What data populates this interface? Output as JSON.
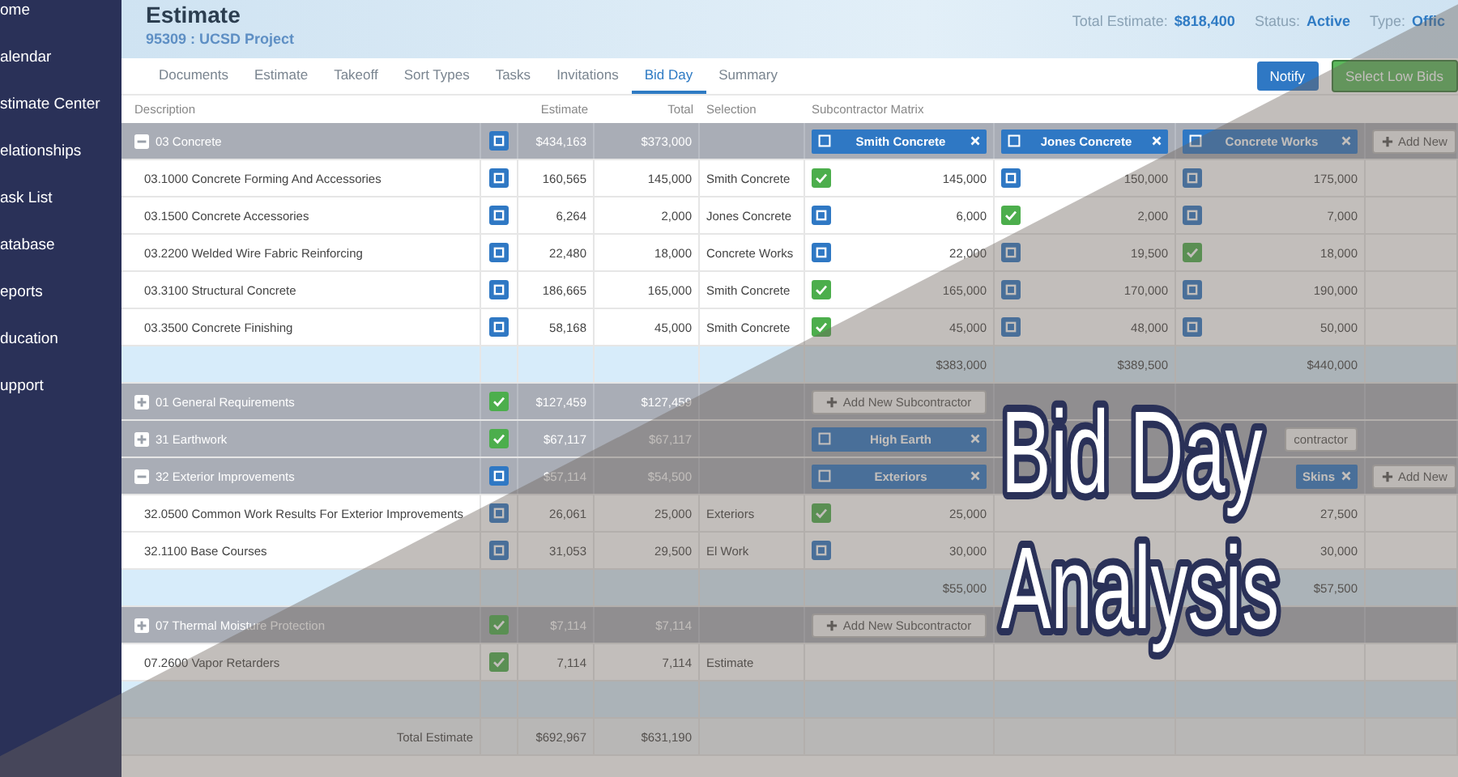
{
  "sidebar": {
    "items": [
      "ome",
      "alendar",
      "stimate Center",
      "elationships",
      "ask List",
      "atabase",
      "eports",
      "ducation",
      "upport"
    ]
  },
  "header": {
    "title": "Estimate",
    "subtitle": "95309 : UCSD Project",
    "info": [
      {
        "label": "Total Estimate:",
        "value": "$818,400"
      },
      {
        "label": "Status:",
        "value": "Active"
      },
      {
        "label": "Type:",
        "value": "Offic"
      }
    ]
  },
  "tabs": [
    {
      "label": "Documents",
      "selected": false
    },
    {
      "label": "Estimate",
      "selected": false
    },
    {
      "label": "Takeoff",
      "selected": false
    },
    {
      "label": "Sort Types",
      "selected": false
    },
    {
      "label": "Tasks",
      "selected": false
    },
    {
      "label": "Invitations",
      "selected": false
    },
    {
      "label": "Bid Day",
      "selected": true
    },
    {
      "label": "Summary",
      "selected": false
    }
  ],
  "buttons": [
    {
      "label": "Notify",
      "kind": "primary"
    },
    {
      "label": "Select Low Bids",
      "kind": "success"
    }
  ],
  "table": {
    "columns": [
      "Description",
      "Estimate",
      "Total",
      "Selection",
      "Subcontractor Matrix"
    ],
    "rows": [
      {
        "kind": "group",
        "expanded": true,
        "label": "03 Concrete",
        "checked": false,
        "estimate": "$434,163",
        "total": "$373,000",
        "subs": {
          "column_1": {
            "kind": "header",
            "label": "Smith Concrete",
            "checked": false
          },
          "column_2": {
            "kind": "header",
            "label": "Jones Concrete",
            "checked": false
          },
          "column_3": {
            "kind": "header",
            "label": "Concrete Works",
            "checked": false
          },
          "column_4": {
            "kind": "add",
            "label": "Add New",
            "icon": true
          }
        }
      },
      {
        "kind": "item",
        "label": "03.1000 Concrete Forming And Accessories",
        "checked": false,
        "estimate": "160,565",
        "total": "145,000",
        "selection": "Smith Concrete",
        "subs": {
          "column_1": {
            "kind": "bid",
            "checked": true,
            "value": "145,000"
          },
          "column_2": {
            "kind": "bid",
            "checked": false,
            "value": "150,000"
          },
          "column_3": {
            "kind": "bid",
            "checked": false,
            "value": "175,000"
          }
        }
      },
      {
        "kind": "item",
        "label": "03.1500 Concrete Accessories",
        "checked": false,
        "estimate": "6,264",
        "total": "2,000",
        "selection": "Jones Concrete",
        "subs": {
          "column_1": {
            "kind": "bid",
            "checked": false,
            "value": "6,000"
          },
          "column_2": {
            "kind": "bid",
            "checked": true,
            "value": "2,000"
          },
          "column_3": {
            "kind": "bid",
            "checked": false,
            "value": "7,000"
          }
        }
      },
      {
        "kind": "item",
        "label": "03.2200 Welded Wire Fabric Reinforcing",
        "checked": false,
        "estimate": "22,480",
        "total": "18,000",
        "selection": "Concrete Works",
        "subs": {
          "column_1": {
            "kind": "bid",
            "checked": false,
            "value": "22,000"
          },
          "column_2": {
            "kind": "bid",
            "checked": false,
            "value": "19,500"
          },
          "column_3": {
            "kind": "bid",
            "checked": true,
            "value": "18,000"
          }
        }
      },
      {
        "kind": "item",
        "label": "03.3100 Structural Concrete",
        "checked": false,
        "estimate": "186,665",
        "total": "165,000",
        "selection": "Smith Concrete",
        "subs": {
          "column_1": {
            "kind": "bid",
            "checked": true,
            "value": "165,000"
          },
          "column_2": {
            "kind": "bid",
            "checked": false,
            "value": "170,000"
          },
          "column_3": {
            "kind": "bid",
            "checked": false,
            "value": "190,000"
          }
        }
      },
      {
        "kind": "item",
        "label": "03.3500 Concrete Finishing",
        "checked": false,
        "estimate": "58,168",
        "total": "45,000",
        "selection": "Smith Concrete",
        "subs": {
          "column_1": {
            "kind": "bid",
            "checked": true,
            "value": "45,000"
          },
          "column_2": {
            "kind": "bid",
            "checked": false,
            "value": "48,000"
          },
          "column_3": {
            "kind": "bid",
            "checked": false,
            "value": "50,000"
          }
        }
      },
      {
        "kind": "subtotal",
        "subs": {
          "column_1": {
            "kind": "total",
            "value": "$383,000"
          },
          "column_2": {
            "kind": "total",
            "value": "$389,500"
          },
          "column_3": {
            "kind": "total",
            "value": "$440,000"
          }
        }
      },
      {
        "kind": "group",
        "expanded": false,
        "label": "01 General Requirements",
        "checked": true,
        "estimate": "$127,459",
        "total": "$127,459",
        "subs": {
          "column_1": {
            "kind": "add",
            "label": "Add New Subcontractor",
            "icon": true
          }
        }
      },
      {
        "kind": "group",
        "expanded": false,
        "label": "31 Earthwork",
        "checked": true,
        "estimate": "$67,117",
        "total": "$67,117",
        "subs": {
          "column_1": {
            "kind": "header",
            "label": "High Earth",
            "checked": false
          },
          "column_3": {
            "kind": "add",
            "label": "contractor",
            "icon": false
          }
        }
      },
      {
        "kind": "group",
        "expanded": true,
        "label": "32 Exterior Improvements",
        "checked": false,
        "estimate": "$57,114",
        "total": "$54,500",
        "subs": {
          "column_1": {
            "kind": "header",
            "label": "Exteriors",
            "checked": false
          },
          "column_3": {
            "kind": "header",
            "label": "Skins"
          },
          "column_4": {
            "kind": "add",
            "label": "Add New",
            "icon": true
          }
        }
      },
      {
        "kind": "item",
        "label": "32.0500 Common Work Results For Exterior Improvements",
        "checked": false,
        "estimate": "26,061",
        "total": "25,000",
        "selection": "Exteriors",
        "subs": {
          "column_1": {
            "kind": "bid",
            "checked": true,
            "value": "25,000"
          },
          "column_3": {
            "kind": "bid",
            "value": "27,500"
          }
        }
      },
      {
        "kind": "item",
        "label": "32.1100 Base Courses",
        "checked": false,
        "estimate": "31,053",
        "total": "29,500",
        "selection": "El Work",
        "subs": {
          "column_1": {
            "kind": "bid",
            "checked": false,
            "value": "30,000"
          },
          "column_3": {
            "kind": "bid",
            "value": "30,000"
          }
        }
      },
      {
        "kind": "subtotal",
        "subs": {
          "column_1": {
            "kind": "total",
            "value": "$55,000"
          },
          "column_3": {
            "kind": "total",
            "value": "$57,500"
          }
        }
      },
      {
        "kind": "group",
        "expanded": false,
        "label": "07 Thermal Moisture Protection",
        "checked": true,
        "estimate": "$7,114",
        "total": "$7,114",
        "subs": {
          "column_1": {
            "kind": "add",
            "label": "Add New Subcontractor",
            "icon": true
          }
        }
      },
      {
        "kind": "item",
        "label": "07.2600 Vapor Retarders",
        "checked": true,
        "estimate": "7,114",
        "total": "7,114",
        "selection": "Estimate"
      },
      {
        "kind": "subtotal"
      },
      {
        "kind": "total",
        "label": "Total Estimate",
        "estimate": "$692,967",
        "total": "$631,190"
      }
    ]
  },
  "overlay_title": [
    "Bid Day",
    "Analysis"
  ]
}
